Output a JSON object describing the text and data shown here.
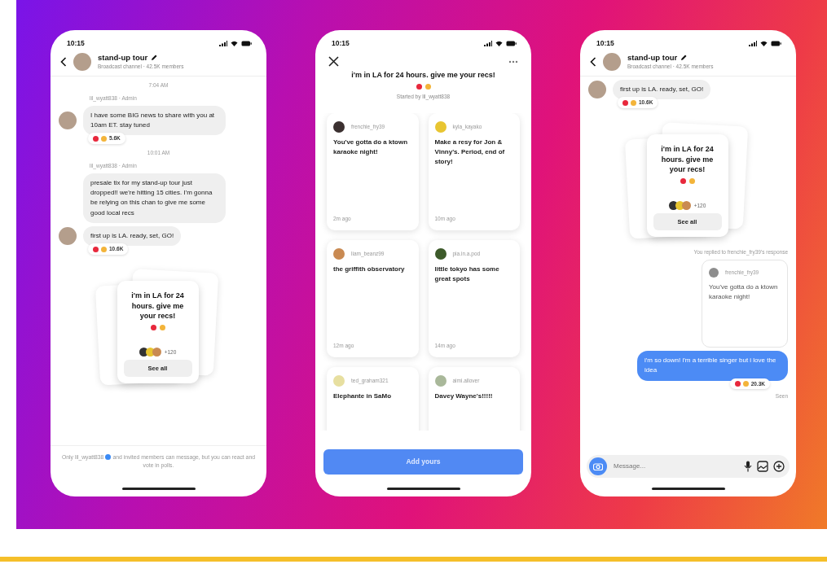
{
  "phones": [
    {
      "kind": "channel",
      "status_time": "10:15",
      "header": {
        "title": "stand-up tour",
        "subtitle": "Broadcast channel · 42.5K members"
      },
      "items": [
        {
          "kind": "timestamp",
          "text": "7:04 AM"
        },
        {
          "kind": "sender",
          "text": "lil_wyatt838 · Admin"
        },
        {
          "kind": "bubble",
          "text": "I have some BIG news to share with you at 10am ET. stay tuned",
          "reactions": "5.6K",
          "avatar": true
        },
        {
          "kind": "timestamp",
          "text": "10:01 AM"
        },
        {
          "kind": "sender",
          "text": "lil_wyatt838 · Admin"
        },
        {
          "kind": "bubble",
          "text": "presale tix for my stand-up tour just dropped!! we're hitting 15 cities. I'm gonna be relying on this chan to give me some good local recs",
          "avatar": false
        },
        {
          "kind": "bubble",
          "text": "first up is LA. ready, set, GO!",
          "reactions": "10.6K",
          "avatar": true
        },
        {
          "kind": "prompt",
          "title": "i'm in LA for 24 hours. give me your recs!",
          "count": "+120",
          "button": "See all"
        }
      ],
      "footer_note": {
        "lead": "Only lil_wyatt838",
        "rest": "and invited members can message, but you can react and vote in polls."
      }
    },
    {
      "kind": "prompt_detail",
      "status_time": "10:15",
      "title": "i'm in LA for 24 hours. give me your recs!",
      "subtitle": "Started by lil_wyatt838",
      "responses": [
        {
          "user": "frenchie_fry39",
          "text": "You've gotta do a ktown karaoke night!",
          "time": "2m ago"
        },
        {
          "user": "kyla_kayako",
          "text": "Make a resy for Jon & Vinny's. Period, end of story!",
          "time": "10m ago"
        },
        {
          "user": "liam_beanz99",
          "text": "the griffith observatory",
          "time": "12m ago"
        },
        {
          "user": "pia.in.a.pod",
          "text": "little tokyo has some great spots",
          "time": "14m ago"
        },
        {
          "user": "ted_graham321",
          "text": "Elephante in SaMo"
        },
        {
          "user": "aimi.allover",
          "text": "Davey Wayne's!!!!!"
        }
      ],
      "button": "Add yours"
    },
    {
      "kind": "channel",
      "status_time": "10:15",
      "header": {
        "title": "stand-up tour",
        "subtitle": "Broadcast channel · 42.5K members"
      },
      "items": [
        {
          "kind": "bubble",
          "text": "first up is LA. ready, set, GO!",
          "reactions": "10.6K",
          "avatar": true
        },
        {
          "kind": "prompt",
          "title": "i'm in LA for 24 hours. give me your recs!",
          "count": "+120",
          "button": "See all"
        },
        {
          "kind": "reply_label",
          "text": "You replied to frenchie_fry39's response"
        },
        {
          "kind": "quote",
          "user": "frenchie_fry39",
          "text": "You've gotta do a ktown karaoke night!"
        },
        {
          "kind": "own_bubble",
          "text": "i'm so down! i'm a terrible singer but i love the idea",
          "reactions": "20.3K"
        },
        {
          "kind": "seen",
          "text": "Seen"
        }
      ],
      "composer": {
        "placeholder": "Message..."
      }
    }
  ]
}
